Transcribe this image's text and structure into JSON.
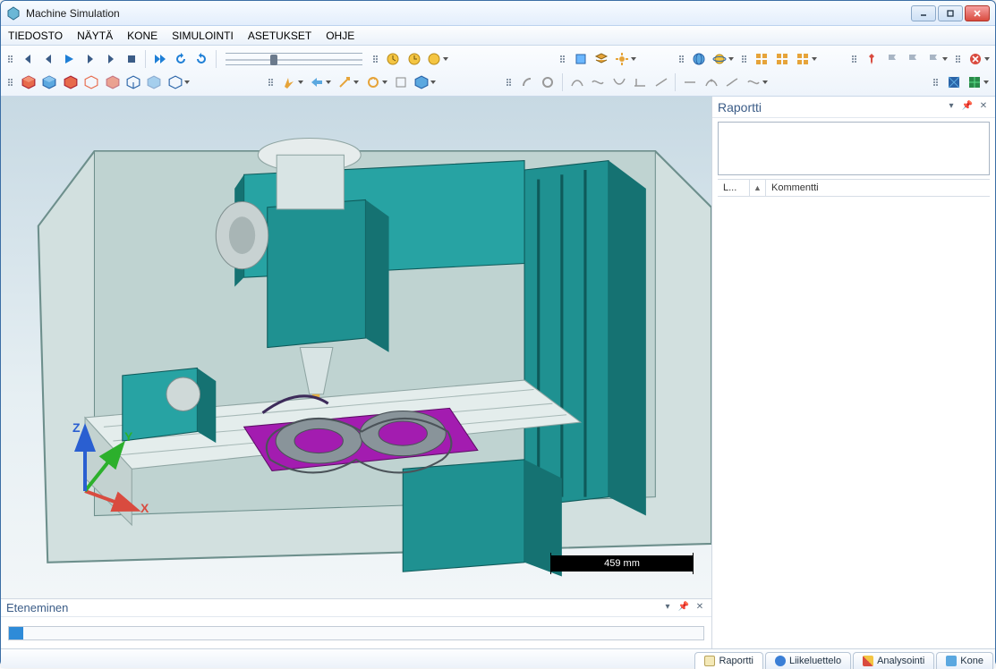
{
  "window": {
    "title": "Machine Simulation"
  },
  "menu": {
    "tiedosto": "TIEDOSTO",
    "nayta": "NÄYTÄ",
    "kone": "KONE",
    "simulointi": "SIMULOINTI",
    "asetukset": "ASETUKSET",
    "ohje": "OHJE"
  },
  "viewport": {
    "scale_label": "459  mm",
    "axes": {
      "x": "X",
      "y": "Y",
      "z": "Z"
    }
  },
  "panels": {
    "progress_title": "Eteneminen",
    "report_title": "Raportti",
    "report_cols": {
      "l": "L...",
      "kommentti": "Kommentti"
    }
  },
  "tabs": {
    "raportti": "Raportti",
    "liikeluettelo": "Liikeluettelo",
    "analysointi": "Analysointi",
    "kone": "Kone"
  },
  "colors": {
    "machine_teal": "#1c8a8a",
    "machine_teal_light": "#3bb3b3",
    "fixture_purple": "#a31cb0",
    "table_gray": "#d8e4e4",
    "frame_gray": "#cbd9d9"
  }
}
